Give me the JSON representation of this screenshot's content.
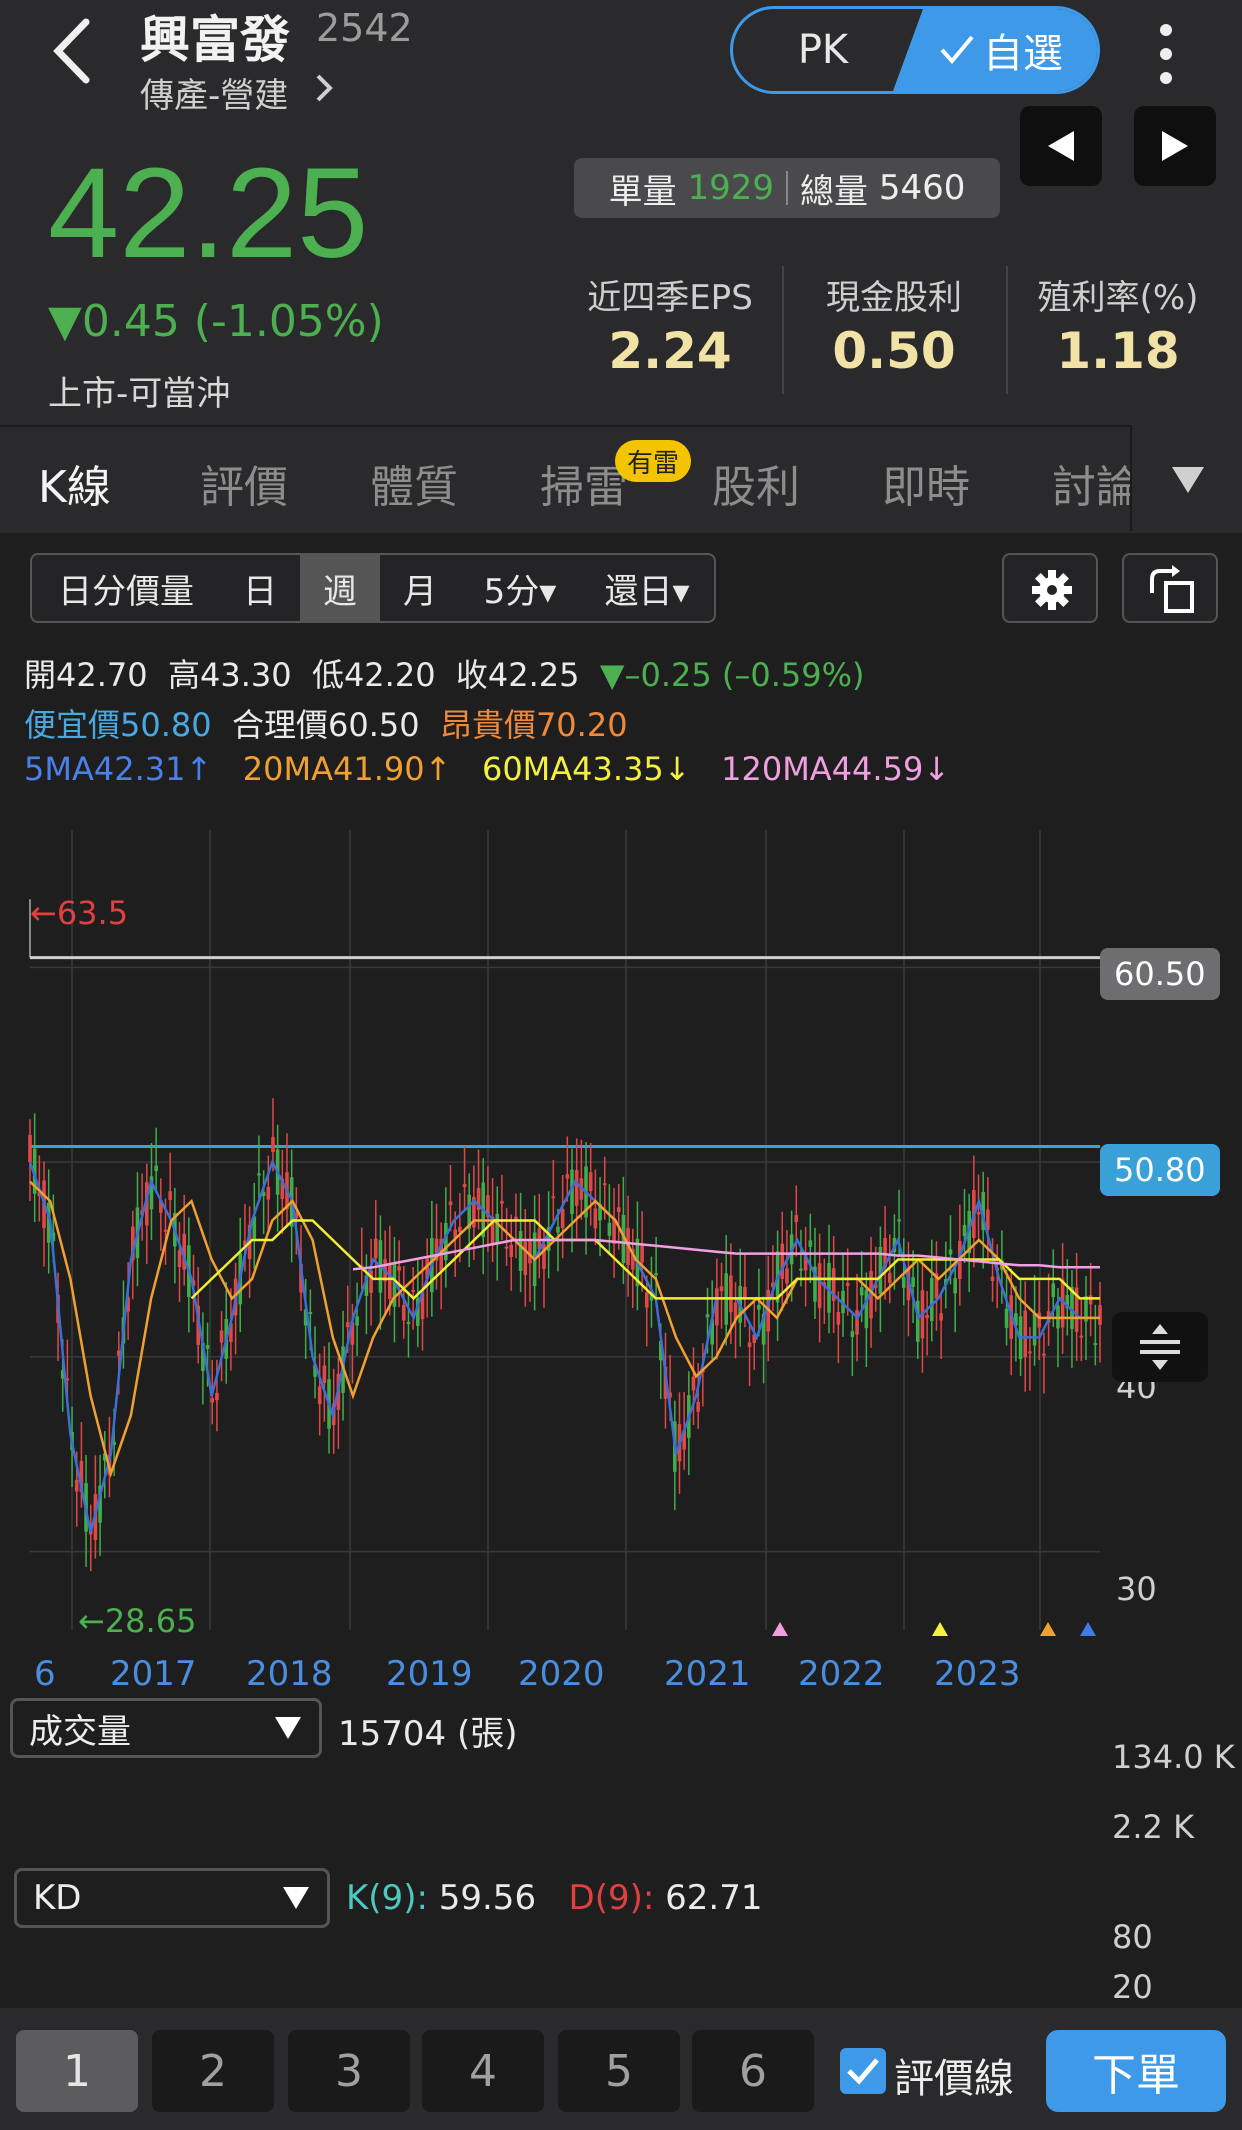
{
  "header": {
    "stock_name": "興富發",
    "stock_code": "2542",
    "sector": "傳產-營建",
    "pk_label": "PK",
    "watch_label": "自選",
    "price": "42.25",
    "change": "▼0.45 (-1.05%)",
    "market": "上市-可當沖",
    "unit_vol_label": "單量",
    "unit_vol": "1929",
    "total_vol_label": "總量",
    "total_vol": "5460",
    "stats": [
      {
        "label": "近四季EPS",
        "value": "2.24"
      },
      {
        "label": "現金股利",
        "value": "0.50"
      },
      {
        "label": "殖利率(%)",
        "value": "1.18"
      }
    ]
  },
  "tabs": {
    "items": [
      "K線",
      "評價",
      "體質",
      "掃雷",
      "股利",
      "即時",
      "討論"
    ],
    "badge": "有雷"
  },
  "toolbar": {
    "periods": [
      "日分價量",
      "日",
      "週",
      "月",
      "5分▾",
      "還日▾"
    ]
  },
  "info": {
    "open": "開42.70",
    "high": "高43.30",
    "low": "低42.20",
    "close": "收42.25",
    "day_change": "▼–0.25 (–0.59%)",
    "cheap": "便宜價50.80",
    "fair": "合理價60.50",
    "expensive": "昂貴價70.20",
    "ma5": "5MA42.31↑",
    "ma20": "20MA41.90↑",
    "ma60": "60MA43.35↓",
    "ma120": "120MA44.59↓"
  },
  "chart_data": {
    "type": "line",
    "title": "",
    "ylim": [
      27,
      65
    ],
    "price_ticks": [
      "40",
      "30"
    ],
    "x_labels": [
      "6",
      "2017",
      "2018",
      "2019",
      "2020",
      "2021",
      "2022",
      "2023"
    ],
    "max_label": "←63.5",
    "min_label": "←28.65",
    "fair_badge": "60.50",
    "cheap_badge": "50.80",
    "fair_price": 60.5,
    "cheap_price": 50.8,
    "series": [
      {
        "name": "5MA",
        "color": "#3b6fd6",
        "values": [
          50,
          47,
          36,
          31,
          35,
          45,
          49,
          47,
          44,
          38,
          42,
          47,
          50,
          48,
          40,
          37,
          42,
          45,
          44,
          42,
          45,
          47,
          48,
          47,
          46,
          45,
          47,
          49,
          48,
          47,
          45,
          43,
          35,
          38,
          43,
          43,
          41,
          44,
          46,
          44,
          43,
          42,
          44,
          46,
          42,
          43,
          45,
          48,
          44,
          41,
          41,
          43,
          42,
          42
        ]
      },
      {
        "name": "20MA",
        "color": "#f0a030",
        "values": [
          49,
          48,
          44,
          38,
          34,
          37,
          43,
          47,
          48,
          45,
          43,
          44,
          47,
          48,
          46,
          41,
          38,
          41,
          43,
          44,
          45,
          46,
          47,
          47,
          46,
          45,
          46,
          47,
          48,
          47,
          45,
          44,
          41,
          39,
          40,
          42,
          43,
          42,
          44,
          44,
          44,
          44,
          43,
          44,
          45,
          44,
          45,
          46,
          45,
          43,
          42,
          42,
          42,
          42
        ]
      },
      {
        "name": "60MA",
        "color": "#f0f030",
        "values": [
          null,
          null,
          null,
          null,
          null,
          null,
          null,
          null,
          43,
          44,
          45,
          46,
          46,
          47,
          47,
          46,
          45,
          44,
          44,
          43,
          44,
          45,
          46,
          47,
          47,
          47,
          46,
          46,
          46,
          45,
          44,
          43,
          43,
          43,
          43,
          43,
          43,
          43,
          44,
          44,
          44,
          44,
          44,
          45,
          45,
          45,
          45,
          45,
          45,
          44,
          44,
          44,
          43,
          43
        ]
      },
      {
        "name": "120MA",
        "color": "#f0a0e0",
        "values": [
          null,
          null,
          null,
          null,
          null,
          null,
          null,
          null,
          null,
          null,
          null,
          null,
          null,
          null,
          null,
          null,
          44.5,
          44.6,
          44.8,
          45,
          45.2,
          45.4,
          45.6,
          45.8,
          46,
          46,
          46,
          46,
          46,
          45.9,
          45.8,
          45.7,
          45.6,
          45.5,
          45.4,
          45.3,
          45.3,
          45.3,
          45.3,
          45.3,
          45.3,
          45.3,
          45.3,
          45.2,
          45.2,
          45.1,
          45,
          44.9,
          44.8,
          44.7,
          44.7,
          44.6,
          44.6,
          44.6
        ]
      }
    ],
    "volume": {
      "label": "成交量",
      "value": "15704 (張)",
      "max_label": "134.0 K",
      "min_label": "2.2 K"
    },
    "kd": {
      "label": "KD",
      "k_name": "K(9):",
      "k_value": "59.56",
      "d_name": "D(9):",
      "d_value": "62.71",
      "ticks": [
        "80",
        "20"
      ]
    }
  },
  "bottom": {
    "pages": [
      "1",
      "2",
      "3",
      "4",
      "5",
      "6"
    ],
    "valuation_label": "評價線",
    "order_label": "下單"
  }
}
